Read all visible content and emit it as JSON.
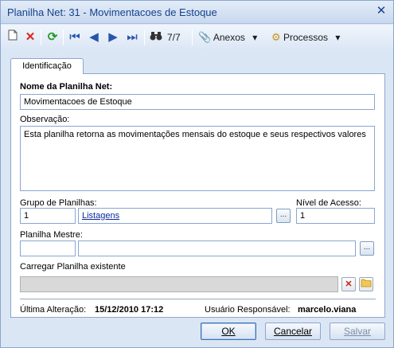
{
  "window": {
    "title": "Planilha Net: 31 - Movimentacoes de Estoque",
    "close_glyph": "✕"
  },
  "toolbar": {
    "counter": "7/7",
    "anexos_label": "Anexos",
    "processos_label": "Processos",
    "dropdown_glyph": "▾"
  },
  "tabs": [
    {
      "label": "Identificação"
    }
  ],
  "form": {
    "nome_label": "Nome da Planilha Net:",
    "nome_value": "Movimentacoes de Estoque",
    "observacao_label": "Observação:",
    "observacao_value": "Esta planilha retorna as movimentações mensais do estoque e seus respectivos valores",
    "grupo_label": "Grupo de Planilhas:",
    "grupo_code": "1",
    "grupo_name": "Listagens",
    "nivel_label": "Nível de Acesso:",
    "nivel_value": "1",
    "mestre_label": "Planilha Mestre:",
    "mestre_code": "",
    "mestre_name": "",
    "carregar_label": "Carregar Planilha existente",
    "carregar_value": "",
    "ellipsis": "..."
  },
  "status": {
    "ultima_label": "Última Alteração:",
    "ultima_value": "15/12/2010 17:12",
    "usuario_label": "Usuário Responsável:",
    "usuario_value": "marcelo.viana"
  },
  "buttons": {
    "ok": "OK",
    "cancelar": "Cancelar",
    "salvar": "Salvar"
  },
  "colors": {
    "accent": "#15428b",
    "delete_red": "#d9261c",
    "refresh_green": "#2a9a2a",
    "nav_blue": "#2756a8"
  }
}
